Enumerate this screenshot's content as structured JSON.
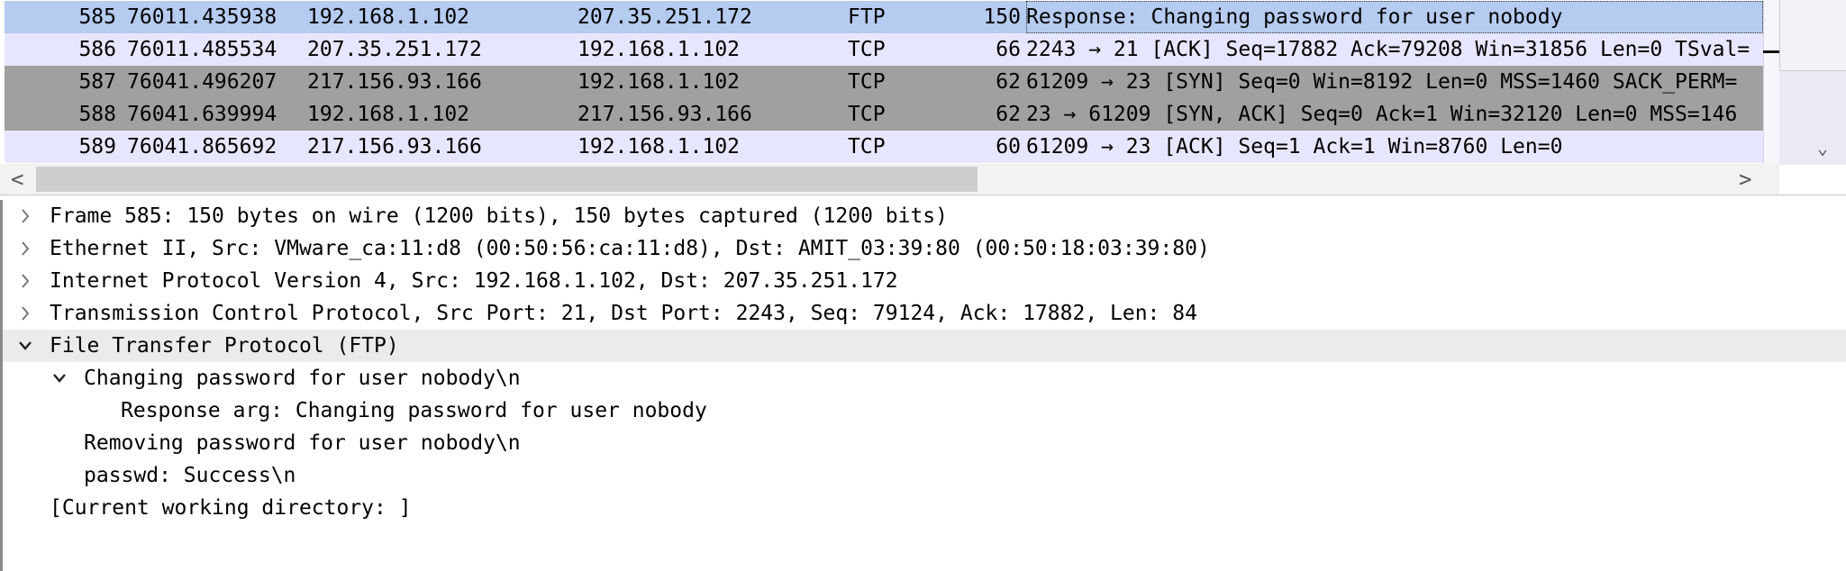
{
  "packet_list": {
    "rows": [
      {
        "no": "585",
        "time": "76011.435938",
        "src": "192.168.1.102",
        "dst": "207.35.251.172",
        "proto": "FTP",
        "len": "150",
        "info": "Response: Changing password for user nobody",
        "bg": "#b5cbf0",
        "selected": true
      },
      {
        "no": "586",
        "time": "76011.485534",
        "src": "207.35.251.172",
        "dst": "192.168.1.102",
        "proto": "TCP",
        "len": "66",
        "info": "2243 → 21 [ACK] Seq=17882 Ack=79208 Win=31856 Len=0 TSval=",
        "bg": "#e7e6ff",
        "selected": false
      },
      {
        "no": "587",
        "time": "76041.496207",
        "src": "217.156.93.166",
        "dst": "192.168.1.102",
        "proto": "TCP",
        "len": "62",
        "info": "61209 → 23 [SYN] Seq=0 Win=8192 Len=0 MSS=1460 SACK_PERM=",
        "bg": "#a0a0a0",
        "selected": false
      },
      {
        "no": "588",
        "time": "76041.639994",
        "src": "192.168.1.102",
        "dst": "217.156.93.166",
        "proto": "TCP",
        "len": "62",
        "info": "23 → 61209 [SYN, ACK] Seq=0 Ack=1 Win=32120 Len=0 MSS=146",
        "bg": "#a0a0a0",
        "selected": false
      },
      {
        "no": "589",
        "time": "76041.865692",
        "src": "217.156.93.166",
        "dst": "192.168.1.102",
        "proto": "TCP",
        "len": "60",
        "info": "61209 → 23 [ACK] Seq=1 Ack=1 Win=8760 Len=0",
        "bg": "#e7e6ff",
        "selected": false
      }
    ]
  },
  "scroll": {
    "left_arrow": "<",
    "right_arrow": ">",
    "down_arrow": "⌄"
  },
  "details": {
    "rows": [
      {
        "text": "Frame 585: 150 bytes on wire (1200 bits), 150 bytes captured (1200 bits)",
        "arrow": "collapsed",
        "indent": 0
      },
      {
        "text": "Ethernet II, Src: VMware_ca:11:d8 (00:50:56:ca:11:d8), Dst: AMIT_03:39:80 (00:50:18:03:39:80)",
        "arrow": "collapsed",
        "indent": 0
      },
      {
        "text": "Internet Protocol Version 4, Src: 192.168.1.102, Dst: 207.35.251.172",
        "arrow": "collapsed",
        "indent": 0
      },
      {
        "text": "Transmission Control Protocol, Src Port: 21, Dst Port: 2243, Seq: 79124, Ack: 17882, Len: 84",
        "arrow": "collapsed",
        "indent": 0
      },
      {
        "text": "File Transfer Protocol (FTP)",
        "arrow": "expanded",
        "indent": 0
      },
      {
        "text": "Changing password for user nobody\\n",
        "arrow": "expanded",
        "indent": 1
      },
      {
        "text": "Response arg: Changing password for user nobody",
        "arrow": "none",
        "indent": 2
      },
      {
        "text": "Removing password for user nobody\\n",
        "arrow": "none",
        "indent": 1
      },
      {
        "text": "passwd: Success\\n",
        "arrow": "none",
        "indent": 1
      },
      {
        "text": "[Current working directory: ]",
        "arrow": "none",
        "indent": 0
      }
    ]
  }
}
